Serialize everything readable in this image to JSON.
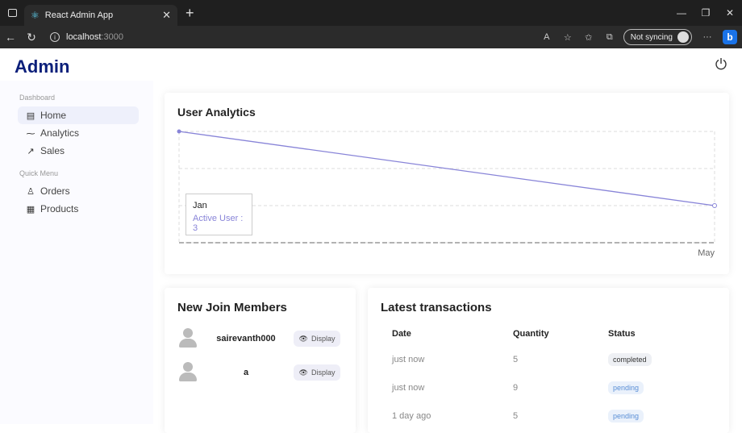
{
  "browser": {
    "tab_title": "React Admin App",
    "url_host": "localhost",
    "url_port": ":3000",
    "sync_label": "Not syncing"
  },
  "app": {
    "brand": "Admin"
  },
  "sidebar": {
    "sections": [
      {
        "title": "Dashboard",
        "items": [
          {
            "label": "Home",
            "icon": "home-icon",
            "active": true
          },
          {
            "label": "Analytics",
            "icon": "trend-icon"
          },
          {
            "label": "Sales",
            "icon": "trending-up-icon"
          }
        ]
      },
      {
        "title": "Quick Menu",
        "items": [
          {
            "label": "Orders",
            "icon": "person-icon"
          },
          {
            "label": "Products",
            "icon": "storefront-icon"
          }
        ]
      }
    ]
  },
  "analytics": {
    "title": "User Analytics",
    "tooltip": {
      "label": "Jan",
      "value_text": "Active User : 3"
    }
  },
  "chart_data": {
    "type": "line",
    "title": "User Analytics",
    "categories": [
      "Jan",
      "May"
    ],
    "series": [
      {
        "values": [
          3,
          1
        ]
      }
    ],
    "x_tick_labels_visible": [
      "May"
    ],
    "grid": true,
    "line_color": "#8884d8"
  },
  "members": {
    "title": "New Join Members",
    "items": [
      {
        "name": "sairevanth000",
        "button": "Display"
      },
      {
        "name": "a",
        "button": "Display"
      }
    ]
  },
  "transactions": {
    "title": "Latest transactions",
    "headers": [
      "Date",
      "Quantity",
      "Status"
    ],
    "rows": [
      {
        "date": "just now",
        "quantity": "5",
        "status": "completed"
      },
      {
        "date": "just now",
        "quantity": "9",
        "status": "pending"
      },
      {
        "date": "1 day ago",
        "quantity": "5",
        "status": "pending"
      }
    ]
  }
}
